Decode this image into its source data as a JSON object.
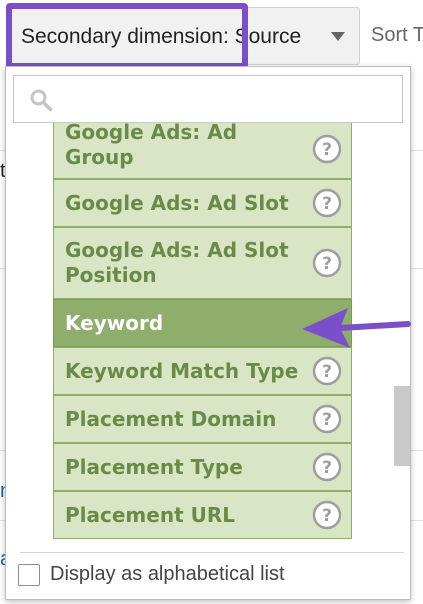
{
  "secondary_dimension": {
    "label": "Secondary dimension: Source"
  },
  "sort": {
    "label": "Sort T"
  },
  "search": {
    "value": "",
    "placeholder": ""
  },
  "dimension_list": {
    "items": [
      {
        "label": "Google Ads: Ad Group",
        "selected": false
      },
      {
        "label": "Google Ads: Ad Slot",
        "selected": false
      },
      {
        "label": "Google Ads: Ad Slot Position",
        "selected": false
      },
      {
        "label": "Keyword",
        "selected": true
      },
      {
        "label": "Keyword Match Type",
        "selected": false
      },
      {
        "label": "Placement Domain",
        "selected": false
      },
      {
        "label": "Placement Type",
        "selected": false
      },
      {
        "label": "Placement URL",
        "selected": false
      }
    ]
  },
  "alphabetical": {
    "label": "Display as alphabetical list",
    "checked": false
  },
  "background": {
    "fragment_t": "t",
    "fragment_a": "a",
    "fragment_n": "n"
  },
  "colors": {
    "item_bg": "#d8e6c5",
    "item_border": "#8fae6b",
    "item_text": "#6b8a4a",
    "selected_bg": "#8fae6b",
    "selected_text": "#ffffff",
    "highlight": "#7b4fc9",
    "arrow": "#7b4fc9"
  },
  "icons": {
    "search": "search-icon",
    "help": "help-icon",
    "dropdown": "chevron-down-icon"
  }
}
